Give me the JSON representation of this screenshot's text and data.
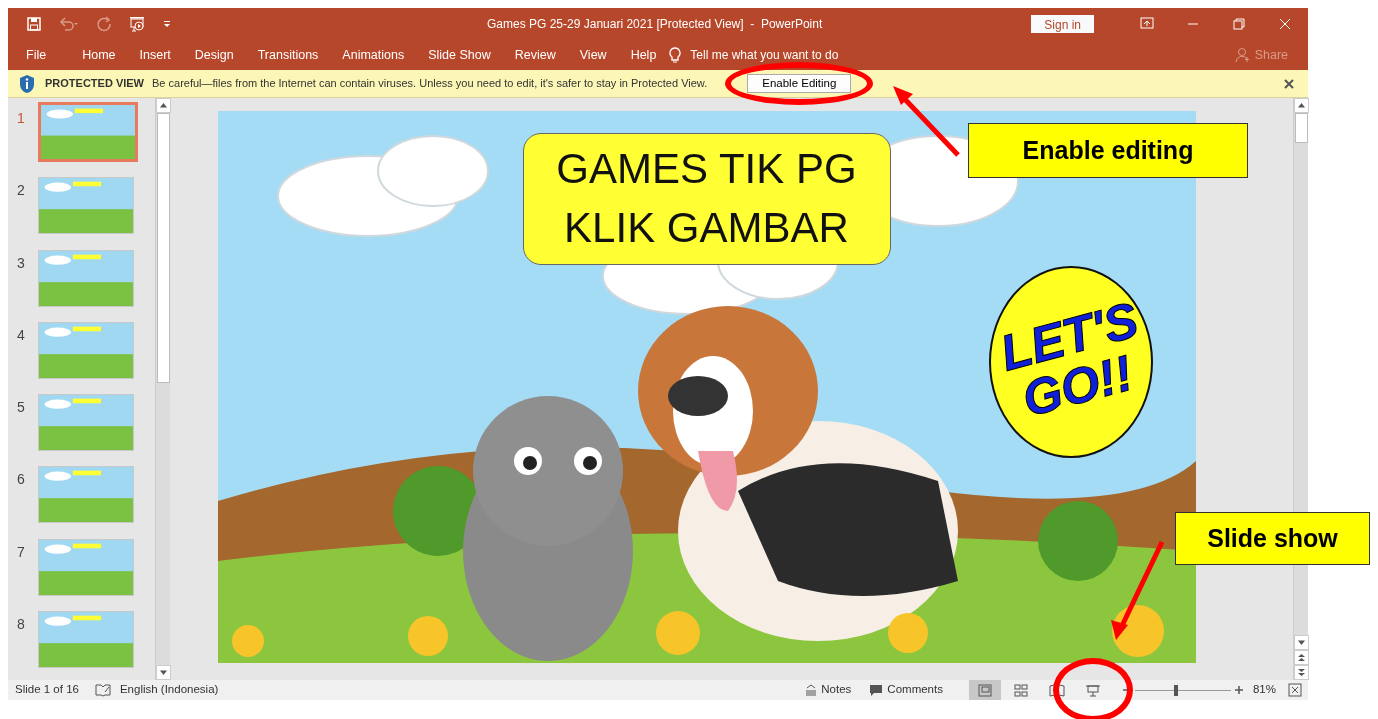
{
  "window": {
    "title": "Games PG 25-29 Januari 2021 [Protected View]  -  PowerPoint",
    "sign_in": "Sign in"
  },
  "ribbon_tabs": [
    {
      "label": "File"
    },
    {
      "label": "Home"
    },
    {
      "label": "Insert"
    },
    {
      "label": "Design"
    },
    {
      "label": "Transitions"
    },
    {
      "label": "Animations"
    },
    {
      "label": "Slide Show"
    },
    {
      "label": "Review"
    },
    {
      "label": "View"
    },
    {
      "label": "Help"
    }
  ],
  "tell_me": {
    "placeholder": "Tell me what you want to do"
  },
  "share": "Share",
  "protected_view": {
    "title": "PROTECTED VIEW",
    "message": "Be careful—files from the Internet can contain viruses. Unless you need to edit, it's safer to stay in Protected View.",
    "button": "Enable Editing"
  },
  "slides": [
    {
      "number": "1",
      "selected": true
    },
    {
      "number": "2",
      "selected": false
    },
    {
      "number": "3",
      "selected": false
    },
    {
      "number": "4",
      "selected": false
    },
    {
      "number": "5",
      "selected": false
    },
    {
      "number": "6",
      "selected": false
    },
    {
      "number": "7",
      "selected": false
    },
    {
      "number": "8",
      "selected": false
    }
  ],
  "slide": {
    "title_lines": [
      "GAMES TIK PG",
      "KLIK GAMBAR"
    ],
    "badge": "LET'S GO!!"
  },
  "status_bar": {
    "slide_info": "Slide 1 of 16",
    "language": "English (Indonesia)",
    "notes": "Notes",
    "comments": "Comments",
    "views": [
      {
        "kind": "normal",
        "selected": true
      },
      {
        "kind": "sorter",
        "selected": false
      },
      {
        "kind": "reading",
        "selected": false
      },
      {
        "kind": "slideshow",
        "selected": false
      }
    ],
    "zoom_slider": {
      "level": 0.42
    },
    "zoom": "81%"
  },
  "annotations": [
    {
      "kind": "editing",
      "text": "Enable editing"
    },
    {
      "kind": "slideshow",
      "text": "Slide show"
    }
  ]
}
